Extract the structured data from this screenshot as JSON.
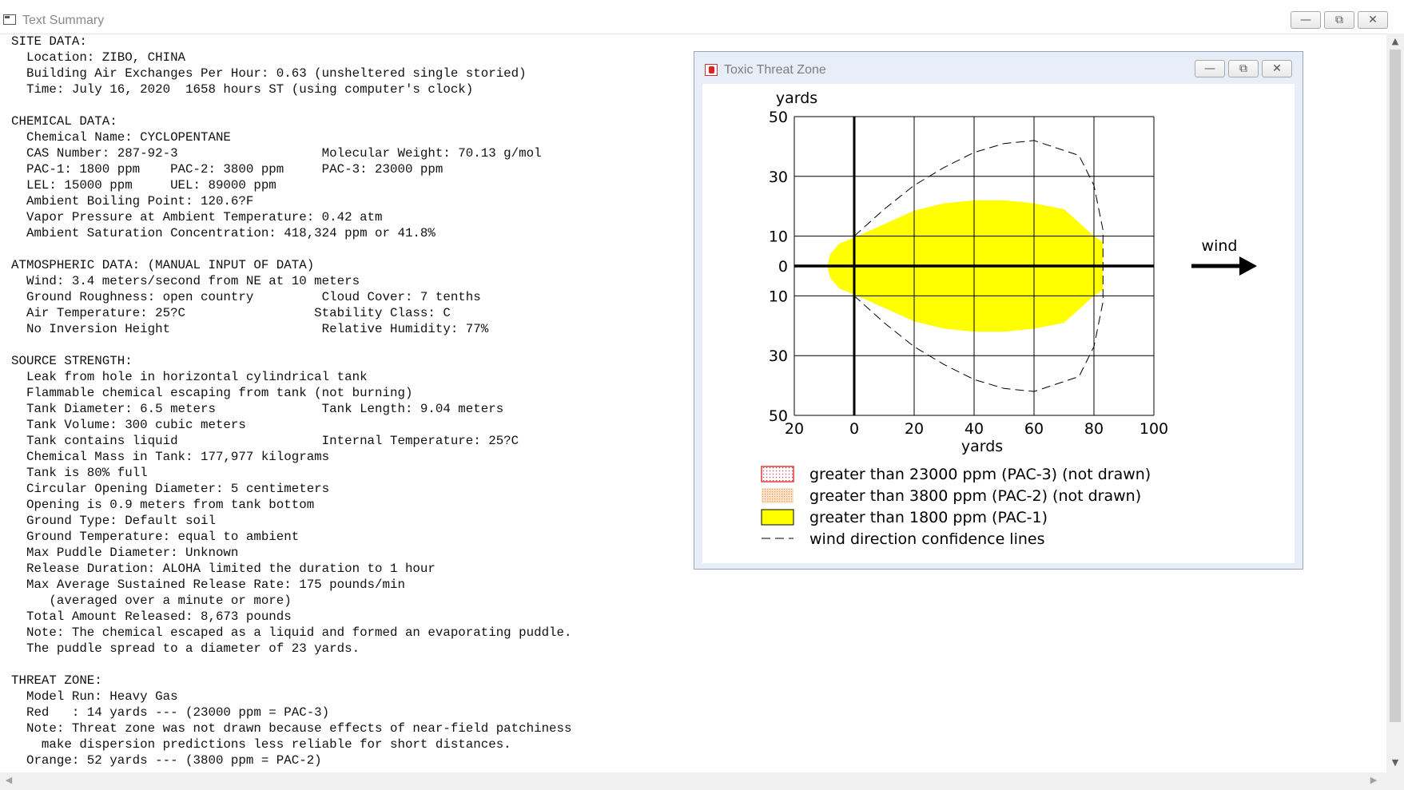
{
  "main_window": {
    "title": "Text Summary"
  },
  "summary_lines": [
    "SITE DATA:",
    "  Location: ZIBO, CHINA",
    "  Building Air Exchanges Per Hour: 0.63 (unsheltered single storied)",
    "  Time: July 16, 2020  1658 hours ST (using computer's clock)",
    "",
    "CHEMICAL DATA:",
    "  Chemical Name: CYCLOPENTANE",
    "  CAS Number: 287-92-3                   Molecular Weight: 70.13 g/mol",
    "  PAC-1: 1800 ppm    PAC-2: 3800 ppm     PAC-3: 23000 ppm",
    "  LEL: 15000 ppm     UEL: 89000 ppm",
    "  Ambient Boiling Point: 120.6?F",
    "  Vapor Pressure at Ambient Temperature: 0.42 atm",
    "  Ambient Saturation Concentration: 418,324 ppm or 41.8%",
    "",
    "ATMOSPHERIC DATA: (MANUAL INPUT OF DATA)",
    "  Wind: 3.4 meters/second from NE at 10 meters",
    "  Ground Roughness: open country         Cloud Cover: 7 tenths",
    "  Air Temperature: 25?C                 Stability Class: C",
    "  No Inversion Height                    Relative Humidity: 77%",
    "",
    "SOURCE STRENGTH:",
    "  Leak from hole in horizontal cylindrical tank",
    "  Flammable chemical escaping from tank (not burning)",
    "  Tank Diameter: 6.5 meters              Tank Length: 9.04 meters",
    "  Tank Volume: 300 cubic meters",
    "  Tank contains liquid                   Internal Temperature: 25?C",
    "  Chemical Mass in Tank: 177,977 kilograms",
    "  Tank is 80% full",
    "  Circular Opening Diameter: 5 centimeters",
    "  Opening is 0.9 meters from tank bottom",
    "  Ground Type: Default soil",
    "  Ground Temperature: equal to ambient",
    "  Max Puddle Diameter: Unknown",
    "  Release Duration: ALOHA limited the duration to 1 hour",
    "  Max Average Sustained Release Rate: 175 pounds/min",
    "     (averaged over a minute or more)",
    "  Total Amount Released: 8,673 pounds",
    "  Note: The chemical escaped as a liquid and formed an evaporating puddle.",
    "  The puddle spread to a diameter of 23 yards.",
    "",
    "THREAT ZONE:",
    "  Model Run: Heavy Gas",
    "  Red   : 14 yards --- (23000 ppm = PAC-3)",
    "  Note: Threat zone was not drawn because effects of near-field patchiness",
    "    make dispersion predictions less reliable for short distances.",
    "  Orange: 52 yards --- (3800 ppm = PAC-2)"
  ],
  "threat_window": {
    "title": "Toxic Threat Zone",
    "wind_label": "wind"
  },
  "window_controls": {
    "minimize": "—",
    "maximize": "⧉",
    "close": "✕"
  },
  "chart_data": {
    "type": "area",
    "ylabel": "yards",
    "xlabel": "yards",
    "xlim": [
      -20,
      100
    ],
    "ylim": [
      -50,
      50
    ],
    "x_ticks": [
      {
        "value": -20,
        "label": "20"
      },
      {
        "value": 0,
        "label": "0"
      },
      {
        "value": 20,
        "label": "20"
      },
      {
        "value": 40,
        "label": "40"
      },
      {
        "value": 60,
        "label": "60"
      },
      {
        "value": 80,
        "label": "80"
      },
      {
        "value": 100,
        "label": "100"
      }
    ],
    "y_ticks": [
      {
        "value": 50,
        "label": "50"
      },
      {
        "value": 30,
        "label": "30"
      },
      {
        "value": 10,
        "label": "10"
      },
      {
        "value": 0,
        "label": "0"
      },
      {
        "value": -10,
        "label": "10"
      },
      {
        "value": -30,
        "label": "30"
      },
      {
        "value": -50,
        "label": "50"
      }
    ],
    "grid": true,
    "pac1_zone": [
      [
        -9,
        0
      ],
      [
        -8,
        4
      ],
      [
        -5,
        7.5
      ],
      [
        0,
        9.5
      ],
      [
        10,
        14
      ],
      [
        20,
        18.5
      ],
      [
        30,
        21
      ],
      [
        40,
        22
      ],
      [
        50,
        22
      ],
      [
        60,
        21
      ],
      [
        70,
        19
      ],
      [
        80,
        10
      ],
      [
        83,
        8
      ],
      [
        83,
        -8
      ],
      [
        80,
        -10
      ],
      [
        70,
        -19
      ],
      [
        60,
        -21
      ],
      [
        50,
        -22
      ],
      [
        40,
        -22
      ],
      [
        30,
        -21
      ],
      [
        20,
        -18.5
      ],
      [
        10,
        -14
      ],
      [
        0,
        -9.5
      ],
      [
        -5,
        -7.5
      ],
      [
        -8,
        -4
      ]
    ],
    "confidence_lines": [
      {
        "points": [
          [
            0,
            10
          ],
          [
            10,
            19
          ],
          [
            20,
            27
          ],
          [
            30,
            33
          ],
          [
            40,
            38
          ],
          [
            50,
            41
          ],
          [
            60,
            42
          ],
          [
            75,
            37
          ],
          [
            80,
            27
          ],
          [
            83,
            12
          ],
          [
            83,
            -12
          ],
          [
            80,
            -27
          ],
          [
            75,
            -37
          ],
          [
            60,
            -42
          ],
          [
            50,
            -41
          ],
          [
            40,
            -38
          ],
          [
            30,
            -33
          ],
          [
            20,
            -27
          ],
          [
            10,
            -19
          ],
          [
            0,
            -10
          ]
        ]
      }
    ],
    "legend": [
      {
        "label": "greater than 23000 ppm (PAC-3) (not drawn)",
        "color": "#e23a3a",
        "style": "dotted-box"
      },
      {
        "label": "greater than 3800 ppm (PAC-2) (not drawn)",
        "color": "#f2a15a",
        "style": "dotted-fill"
      },
      {
        "label": "greater than 1800 ppm (PAC-1)",
        "color": "#ffff00",
        "style": "solid-fill"
      },
      {
        "label": "wind direction confidence lines",
        "color": "#000000",
        "style": "dashed-line"
      }
    ],
    "legend_position": "bottom"
  }
}
